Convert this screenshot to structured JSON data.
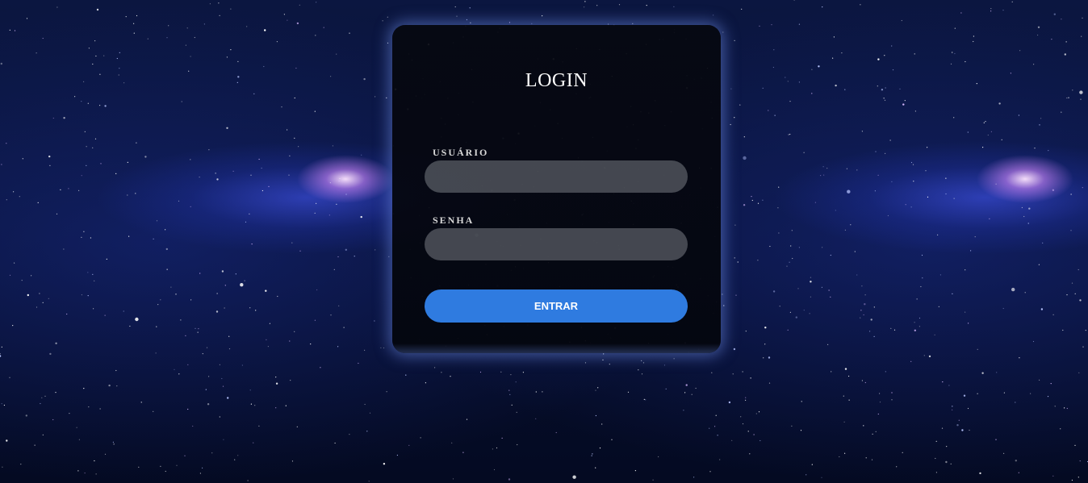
{
  "background": {
    "theme": "galaxy-starfield",
    "colors": {
      "deep": "#050a1e",
      "nebula": "#3a52d8",
      "core": "#f4d6ff"
    }
  },
  "login_card": {
    "title": "LOGIN",
    "username_label": "USUÁRIO",
    "username_value": "",
    "password_label": "SENHA",
    "password_value": "",
    "submit_label": "ENTRAR",
    "colors": {
      "button": "#2f7be0",
      "field": "#6f737b"
    }
  }
}
